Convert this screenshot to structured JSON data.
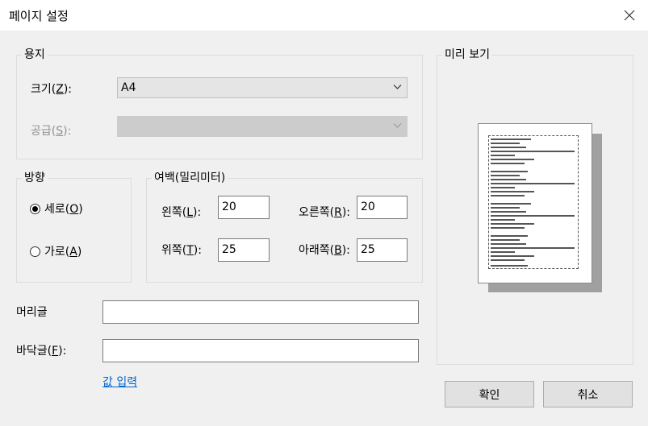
{
  "window": {
    "title": "페이지 설정"
  },
  "paper": {
    "legend": "용지",
    "size_label": "크기(",
    "size_key": "Z",
    "size_suffix": "):",
    "size_value": "A4",
    "source_label": "공급(",
    "source_key": "S",
    "source_suffix": "):",
    "source_value": ""
  },
  "orientation": {
    "legend": "방향",
    "portrait": "세로(",
    "portrait_key": "O",
    "landscape": "가로(",
    "landscape_key": "A",
    "close_paren": ")",
    "selected": "portrait"
  },
  "margins": {
    "legend": "여백(밀리미터)",
    "left_label": "왼쪽(",
    "left_key": "L",
    "left_value": "20",
    "right_label": "오른쪽(",
    "right_key": "R",
    "right_value": "20",
    "top_label": "위쪽(",
    "top_key": "T",
    "top_value": "25",
    "bottom_label": "아래쪽(",
    "bottom_key": "B",
    "bottom_value": "25",
    "suffix": "):"
  },
  "header": {
    "label": "머리글",
    "value": ""
  },
  "footer": {
    "label": "바닥글(",
    "key": "F",
    "suffix": "):",
    "value": ""
  },
  "input_values_link": "값 입력",
  "preview": {
    "legend": "미리 보기"
  },
  "buttons": {
    "ok": "확인",
    "cancel": "취소"
  }
}
